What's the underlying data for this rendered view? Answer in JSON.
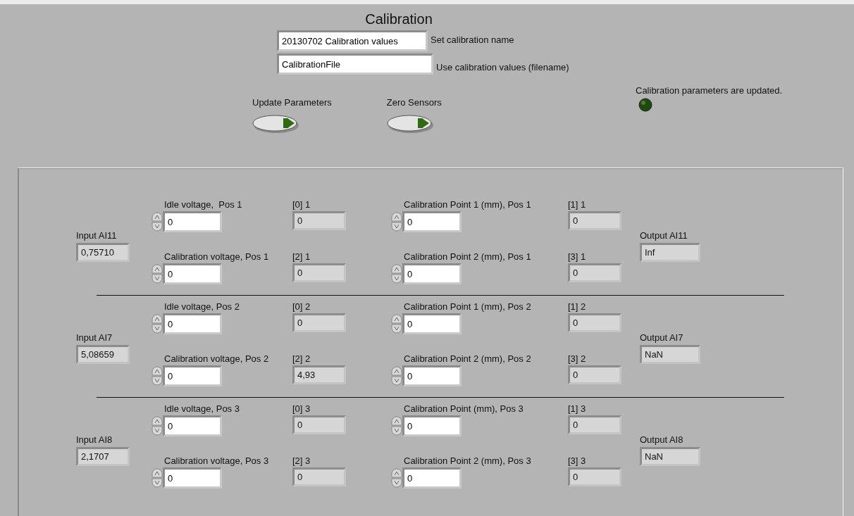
{
  "title": "Calibration",
  "name_field": {
    "value": "20130702 Calibration values",
    "label": "Set calibration name"
  },
  "file_field": {
    "value": "CalibrationFile",
    "label": "Use calibration values (filename)"
  },
  "buttons": [
    {
      "label": "Update Parameters"
    },
    {
      "label": "Zero Sensors"
    }
  ],
  "status_led": {
    "label": "Calibration parameters are updated.",
    "on": false
  },
  "groups": [
    {
      "input": {
        "label": "Input AI11",
        "value": "0,75710"
      },
      "output": {
        "label": "Output AI11",
        "value": "Inf"
      },
      "rows": [
        {
          "left": {
            "label": "Idle voltage,  Pos 1",
            "value": "0"
          },
          "left_index": {
            "label": "[0] 1",
            "value": "0"
          },
          "right": {
            "label": "Calibration Point 1 (mm), Pos 1",
            "value": "0"
          },
          "right_index": {
            "label": "[1] 1",
            "value": "0"
          }
        },
        {
          "left": {
            "label": "Calibration voltage, Pos 1",
            "value": "0"
          },
          "left_index": {
            "label": "[2] 1",
            "value": "0"
          },
          "right": {
            "label": "Calibration Point 2 (mm), Pos 1",
            "value": "0"
          },
          "right_index": {
            "label": "[3] 1",
            "value": "0"
          }
        }
      ]
    },
    {
      "input": {
        "label": "Input AI7",
        "value": "5,08659"
      },
      "output": {
        "label": "Output AI7",
        "value": "NaN"
      },
      "rows": [
        {
          "left": {
            "label": "Idle voltage, Pos 2",
            "value": "0"
          },
          "left_index": {
            "label": "[0] 2",
            "value": "0"
          },
          "right": {
            "label": "Calibration Point 1 (mm), Pos 2",
            "value": "0"
          },
          "right_index": {
            "label": "[1] 2",
            "value": "0"
          }
        },
        {
          "left": {
            "label": "Calibration voltage, Pos 2",
            "value": "0"
          },
          "left_index": {
            "label": "[2] 2",
            "value": "4,93"
          },
          "right": {
            "label": "Calibration Point 2 (mm), Pos 2",
            "value": "0"
          },
          "right_index": {
            "label": "[3] 2",
            "value": "0"
          }
        }
      ]
    },
    {
      "input": {
        "label": "Input AI8",
        "value": "2,1707"
      },
      "output": {
        "label": "Output AI8",
        "value": "NaN"
      },
      "rows": [
        {
          "left": {
            "label": "Idle voltage, Pos 3",
            "value": "0"
          },
          "left_index": {
            "label": "[0] 3",
            "value": "0"
          },
          "right": {
            "label": "Calibration Point (mm), Pos 3",
            "value": "0"
          },
          "right_index": {
            "label": "[1] 3",
            "value": "0"
          }
        },
        {
          "left": {
            "label": "Calibration voltage, Pos 3",
            "value": "0"
          },
          "left_index": {
            "label": "[2] 3",
            "value": "0"
          },
          "right": {
            "label": "Calibration Point 2 (mm), Pos 3",
            "value": "0"
          },
          "right_index": {
            "label": "[3] 3",
            "value": "0"
          }
        }
      ]
    }
  ]
}
